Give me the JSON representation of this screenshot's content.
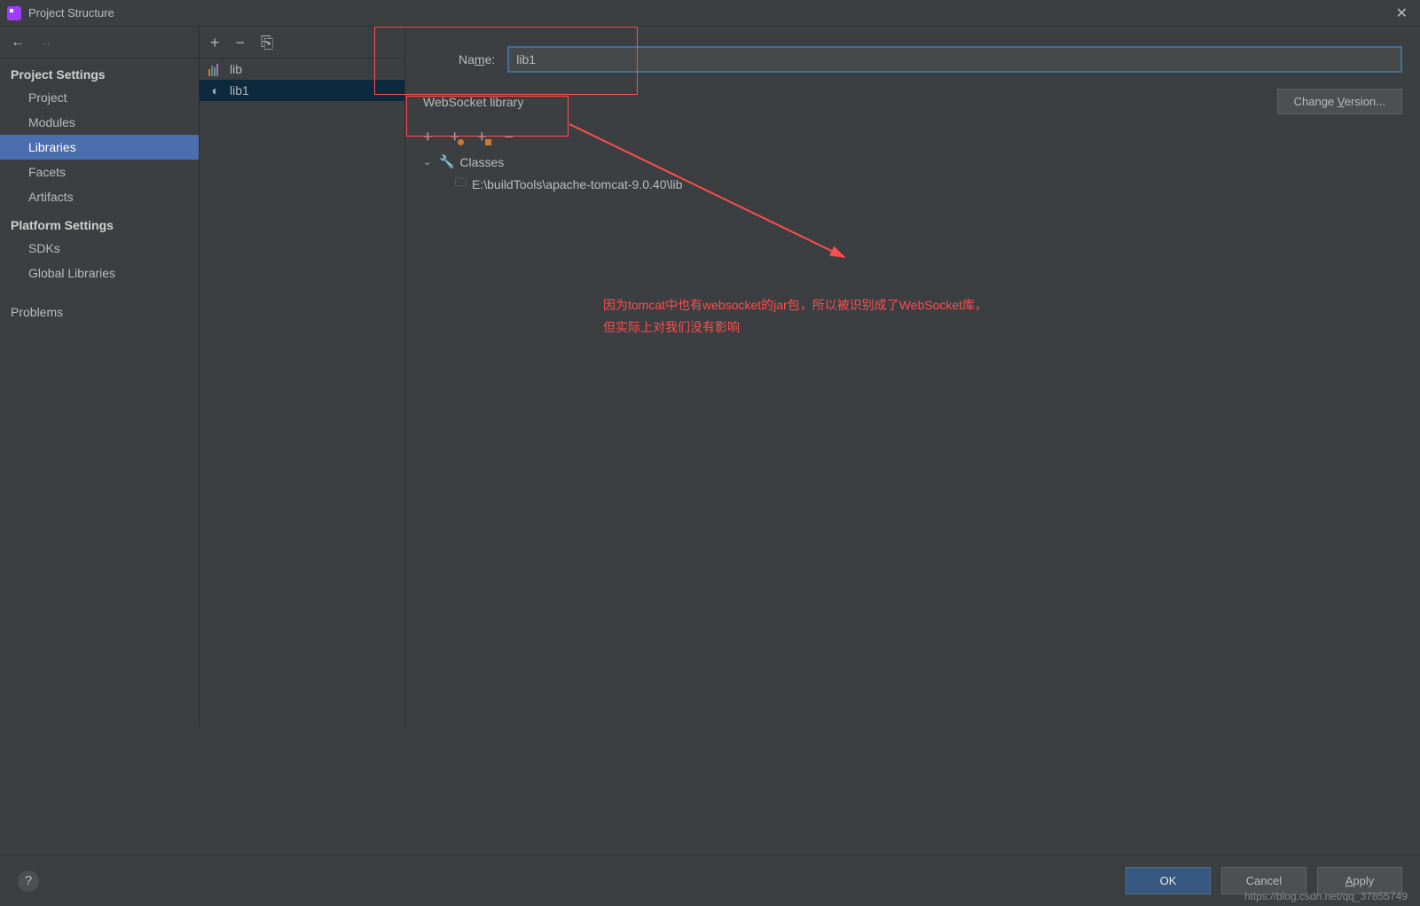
{
  "window": {
    "title": "Project Structure"
  },
  "sidebar": {
    "section1": "Project Settings",
    "items1": [
      "Project",
      "Modules",
      "Libraries",
      "Facets",
      "Artifacts"
    ],
    "section2": "Platform Settings",
    "items2": [
      "SDKs",
      "Global Libraries"
    ],
    "problems": "Problems"
  },
  "libs": {
    "items": [
      {
        "name": "lib",
        "kind": "bars"
      },
      {
        "name": "lib1",
        "kind": "ws"
      }
    ]
  },
  "detail": {
    "name_label_pre": "Na",
    "name_label_u": "m",
    "name_label_post": "e:",
    "name_value": "lib1",
    "lib_type": "WebSocket library",
    "change_version_pre": "Change ",
    "change_version_u": "V",
    "change_version_post": "ersion...",
    "classes_label": "Classes",
    "path": "E:\\buildTools\\apache-tomcat-9.0.40\\lib"
  },
  "annotation": {
    "line1": "因为tomcat中也有websocket的jar包，所以被识别成了WebSocket库，",
    "line2": "但实际上对我们没有影响"
  },
  "footer": {
    "ok": "OK",
    "cancel": "Cancel",
    "apply_u": "A",
    "apply_post": "pply"
  },
  "watermark": "https://blog.csdn.net/qq_37855749"
}
